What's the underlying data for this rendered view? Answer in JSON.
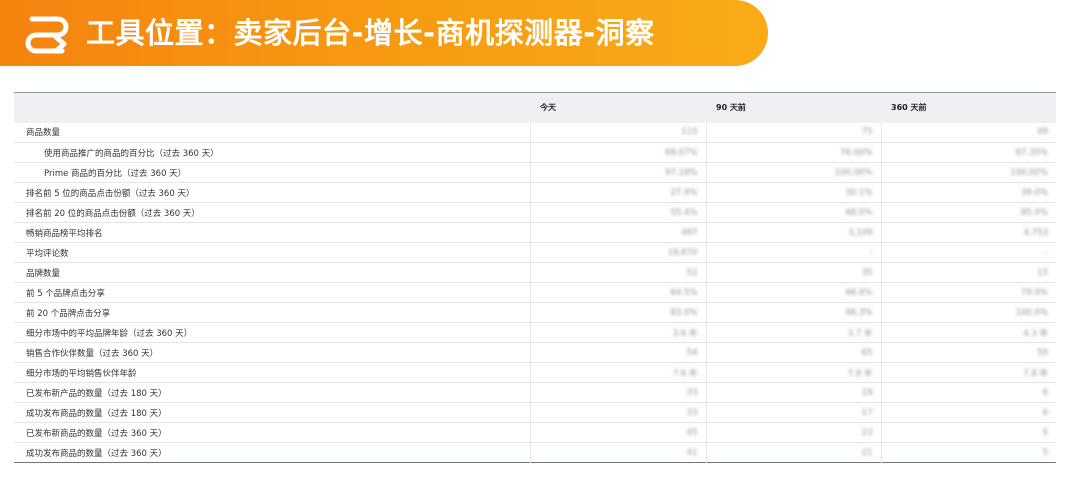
{
  "banner": {
    "title": "工具位置：卖家后台-增长-商机探测器-洞察",
    "icon": "route-arrow-icon",
    "color": "#f7901a"
  },
  "table": {
    "columns": [
      "",
      "今天",
      "90 天前",
      "360 天前"
    ],
    "rows": [
      {
        "label": "商品数量",
        "indent": false,
        "values": [
          "110",
          "75",
          "49"
        ]
      },
      {
        "label": "使用商品推广的商品的百分比（过去 360 天）",
        "indent": true,
        "values": [
          "69.07%",
          "76.00%",
          "67.35%"
        ]
      },
      {
        "label": "Prime 商品的百分比（过去 360 天）",
        "indent": true,
        "values": [
          "97.19%",
          "100.00%",
          "100.00%"
        ]
      },
      {
        "label": "排名前 5 位的商品点击份额（过去 360 天）",
        "indent": false,
        "values": [
          "27.9%",
          "30.1%",
          "39.0%"
        ]
      },
      {
        "label": "排名前 20 位的商品点击份额（过去 360 天）",
        "indent": false,
        "values": [
          "55.4%",
          "68.0%",
          "85.0%"
        ]
      },
      {
        "label": "畅销商品榜平均排名",
        "indent": false,
        "values": [
          "497",
          "3,109",
          "4,753"
        ]
      },
      {
        "label": "平均评论数",
        "indent": false,
        "values": [
          "19,670",
          "-",
          "-"
        ]
      },
      {
        "label": "品牌数量",
        "indent": false,
        "values": [
          "52",
          "35",
          "15"
        ]
      },
      {
        "label": "前 5 个品牌点击分享",
        "indent": false,
        "values": [
          "64.5%",
          "66.8%",
          "79.9%"
        ]
      },
      {
        "label": "前 20 个品牌点击分享",
        "indent": false,
        "values": [
          "83.0%",
          "96.3%",
          "100.0%"
        ]
      },
      {
        "label": "细分市场中的平均品牌年龄（过去 360 天）",
        "indent": false,
        "values": [
          "3.6 年",
          "3.7 年",
          "4.3 年"
        ]
      },
      {
        "label": "销售合作伙伴数量（过去 360 天）",
        "indent": false,
        "values": [
          "54",
          "65",
          "50"
        ]
      },
      {
        "label": "细分市场的平均销售伙伴年龄",
        "indent": false,
        "values": [
          "7.6 年",
          "7.8 年",
          "7.8 年"
        ]
      },
      {
        "label": "已发布新产品的数量（过去 180 天）",
        "indent": false,
        "values": [
          "33",
          "19",
          "6"
        ]
      },
      {
        "label": "成功发布商品的数量（过去 180 天）",
        "indent": false,
        "values": [
          "33",
          "17",
          "6"
        ]
      },
      {
        "label": "已发布新商品的数量（过去 360 天）",
        "indent": false,
        "values": [
          "45",
          "23",
          "5"
        ]
      },
      {
        "label": "成功发布商品的数量（过去 360 天）",
        "indent": false,
        "values": [
          "41",
          "21",
          "5"
        ]
      }
    ]
  }
}
